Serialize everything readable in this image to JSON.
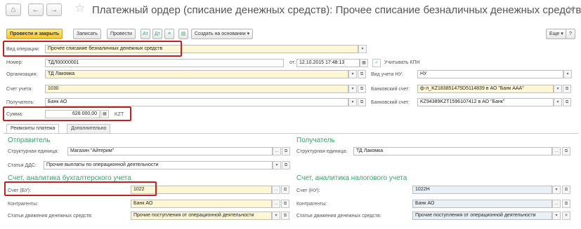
{
  "window": {
    "title": "Платежный ордер (списание денежных средств): Прочее списание безналичных денежных средств..."
  },
  "nav": {
    "home": "⌂",
    "back": "←",
    "forward": "→",
    "star": "☆",
    "close": "✕"
  },
  "toolbar": {
    "post_close": "Провести и закрыть",
    "save": "Записать",
    "post": "Провести",
    "icon1": "Ат",
    "icon2": "Дт",
    "icon3": "≡",
    "icon4": "▤",
    "create_basis": "Создать на основании ▾",
    "more": "Еще ▾",
    "help": "?"
  },
  "form": {
    "operation": {
      "label": "Вид операции:",
      "value": "Прочее списание безналичных денежных средств"
    },
    "number": {
      "label": "Номер:",
      "value": "ТДЛ00000001"
    },
    "date": {
      "label": "от:",
      "value": "12.10.2015 17:48:13"
    },
    "kpn": {
      "label": "Учитывать КПН",
      "check": "✓"
    },
    "org": {
      "label": "Организация:",
      "value": "ТД Лакомка"
    },
    "tax_acc_type": {
      "label": "Вид учета НУ:",
      "value": "НУ"
    },
    "account": {
      "label": "Счет учета:",
      "value": "1030"
    },
    "bank_acc": {
      "label": "Банковский счет:",
      "value": "ф-л_KZ183851475D5114839 в АО \"Банк ААА\""
    },
    "recipient": {
      "label": "Получатель:",
      "value": "Банк АО"
    },
    "bank_acc2": {
      "label": "Банковский счет:",
      "value": "KZ94389KZT1596107412 в АО \"Банк\""
    },
    "amount": {
      "label": "Сумма:",
      "value": "628 000,00",
      "currency": "KZT"
    }
  },
  "tabs": [
    "Реквизиты платежа",
    "Дополнительно"
  ],
  "sender": {
    "heading": "Отправитель",
    "unit_label": "Структурная единица:",
    "unit_value": "Магазин \"Айтерим\"",
    "dds_label": "Статья ДДС:",
    "dds_value": "Прочие выплаты по операционной деятельности"
  },
  "receiver": {
    "heading": "Получатель",
    "unit_label": "Структурная единица:",
    "unit_value": "ТД Лакомка"
  },
  "buh": {
    "heading": "Счет, аналитика бухгалтерского учета",
    "acc_label": "Счет (БУ):",
    "acc_value": "1022",
    "contr_label": "Контрагенты:",
    "contr_value": "Банк АО",
    "flow_label": "Статьи движения денежных средств:",
    "flow_value": "Прочие поступления от операционной деятельности"
  },
  "tax": {
    "heading": "Счет, аналитика налогового учета",
    "acc_label": "Счет (НУ):",
    "acc_value": "1022Н",
    "contr_label": "Контрагенты:",
    "contr_value": "Банк АО",
    "flow_label": "Статьи движения денежных средств:",
    "flow_value": "Прочие поступления от операционной деятельности"
  },
  "btn": {
    "select": "…",
    "dropdown": "▾",
    "open": "⧉",
    "clear": "✕",
    "calc": "▦"
  },
  "colors": {
    "accent": "#f2c530",
    "section": "#3a9f6c",
    "highlight": "#c62020"
  }
}
